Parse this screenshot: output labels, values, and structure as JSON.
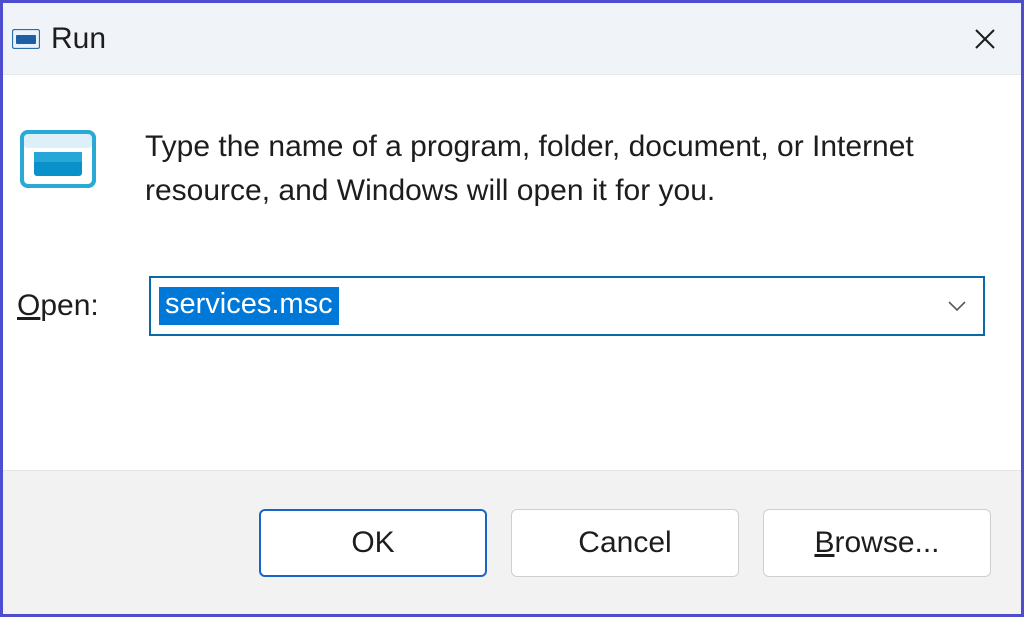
{
  "titlebar": {
    "title": "Run"
  },
  "content": {
    "description": "Type the name of a program, folder, document, or Internet resource, and Windows will open it for you.",
    "open_label_prefix": "O",
    "open_label_rest": "pen:",
    "input_value": "services.msc"
  },
  "buttons": {
    "ok": "OK",
    "cancel": "Cancel",
    "browse_prefix": "B",
    "browse_rest": "rowse..."
  }
}
